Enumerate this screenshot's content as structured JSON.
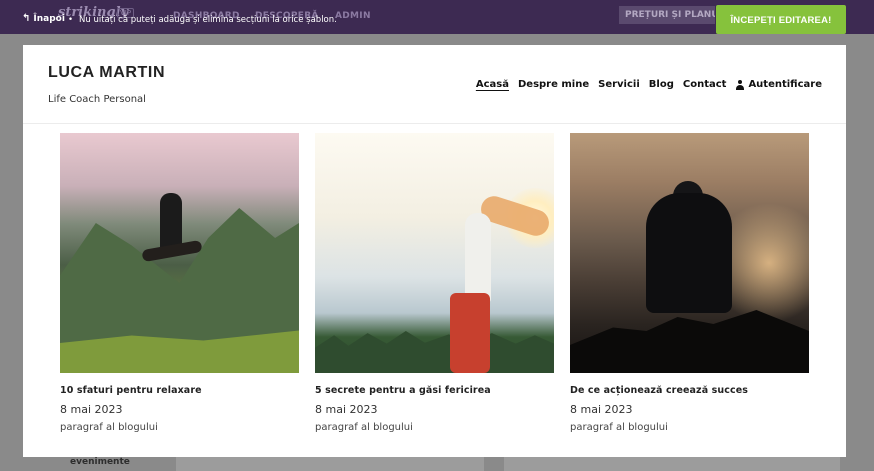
{
  "background": {
    "logo": "strikingly",
    "vip": "VIP",
    "nav": [
      "DASHBOARD",
      "DESCOPERĂ",
      "ADMIN"
    ],
    "pricing": "PREȚURI ȘI PLANURI",
    "events": "evenimente"
  },
  "notice": {
    "back_label": "Înapoi",
    "message": "Nu uitați că puteți adăuga și elimina secțiuni la orice șablon."
  },
  "start_button": "ÎNCEPEȚI EDITAREA!",
  "site": {
    "name": "LUCA MARTIN",
    "tagline": "Life Coach Personal",
    "nav": {
      "home": "Acasă",
      "about": "Despre mine",
      "services": "Servicii",
      "blog": "Blog",
      "contact": "Contact",
      "login": "Autentificare"
    }
  },
  "posts": [
    {
      "title": "10 sfaturi pentru relaxare",
      "date": "8 mai 2023",
      "excerpt": "paragraf al blogului"
    },
    {
      "title": "5 secrete pentru a găsi fericirea",
      "date": "8 mai 2023",
      "excerpt": "paragraf al blogului"
    },
    {
      "title": "De ce acționează creează succes",
      "date": "8 mai 2023",
      "excerpt": "paragraf al blogului"
    }
  ],
  "colors": {
    "topbar": "#3d2a52",
    "accent_green": "#86c23c"
  }
}
